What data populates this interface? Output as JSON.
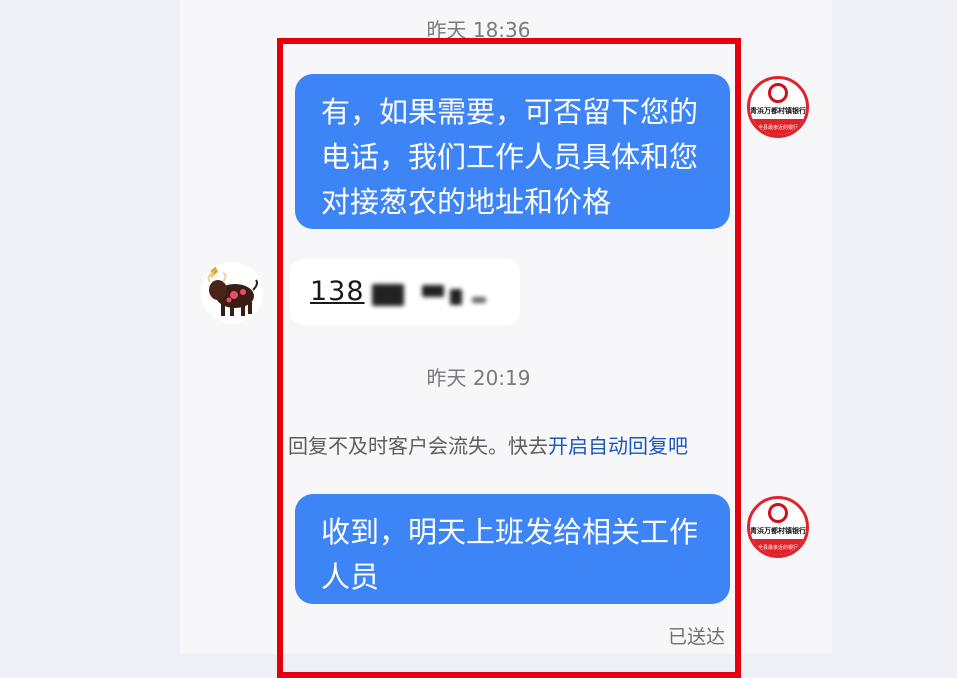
{
  "chat": {
    "timestamp_1": "昨天 18:36",
    "message_1": "有，如果需要，可否留下您的电话，我们工作人员具体和您对接葱农的地址和价格",
    "reply_phone_prefix": "138",
    "timestamp_2": "昨天 20:19",
    "notice_text": "回复不及时客户会流失。快去",
    "notice_link": "开启自动回复吧",
    "message_2": "收到，明天上班发给相关工作人员",
    "delivery_status": "已送达"
  },
  "bank_avatar": {
    "name": "青浜万都村镇银行",
    "slogan": "全县最亲近的银行"
  },
  "colors": {
    "bubble_outgoing": "#3d84f7",
    "highlight_border": "#e6000e",
    "notice_link": "#1c57b8"
  },
  "icons": {
    "user_avatar": "bull-icon",
    "bank_avatar": "bank-logo-icon"
  }
}
